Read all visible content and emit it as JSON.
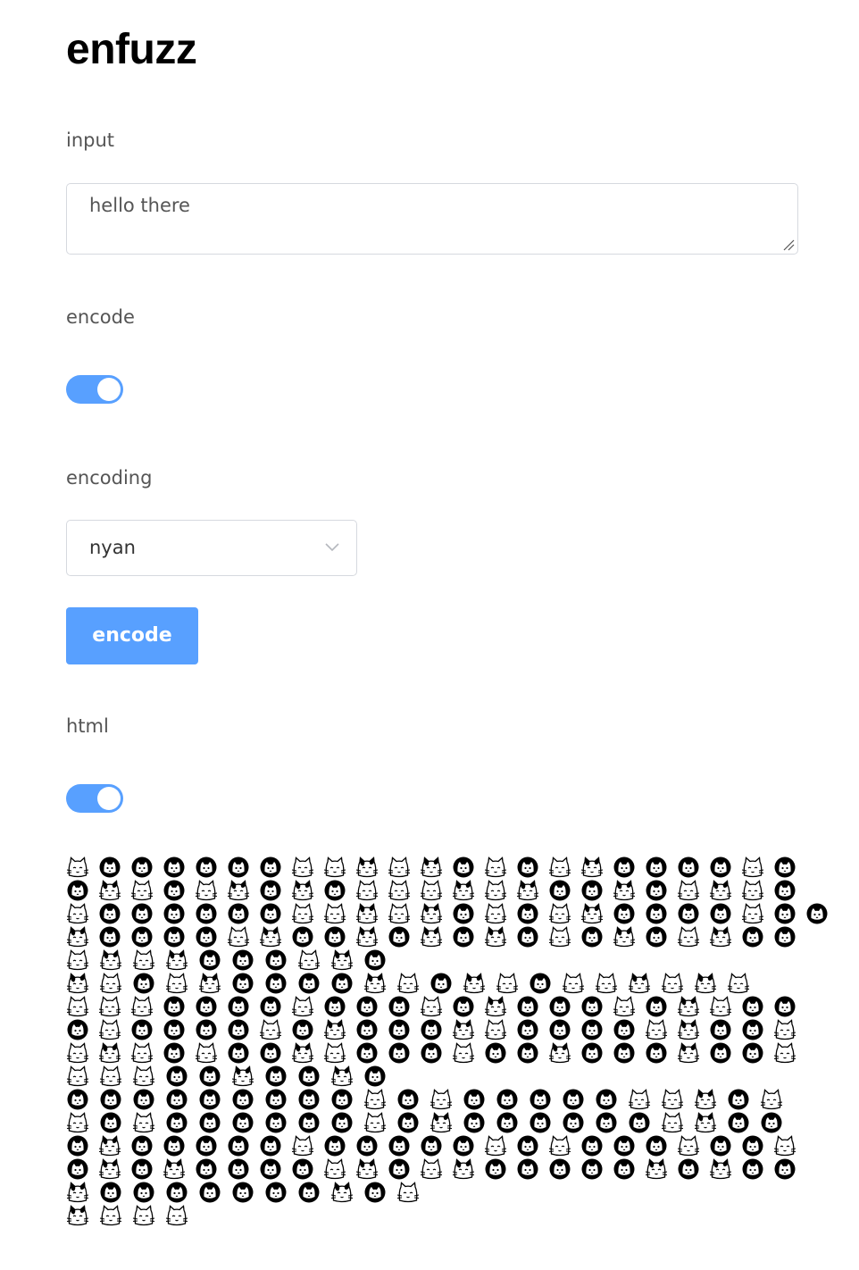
{
  "app": {
    "title": "enfuzz"
  },
  "input": {
    "label": "input",
    "value": "hello there"
  },
  "encode_toggle": {
    "label": "encode",
    "on": true
  },
  "encoding": {
    "label": "encoding",
    "selected": "nyan"
  },
  "encode_button": {
    "label": "encode"
  },
  "html_toggle": {
    "label": "html",
    "on": true
  },
  "colors": {
    "accent": "#58a0ff",
    "text": "#555555",
    "border": "#d6d9df"
  },
  "output": {
    "glyph_type": "cat-face-icon",
    "lines": [
      "wbbbbbbwwcwcbwbwcbbbbwb",
      "bcwbwcbcbwwwcwcbbcbwcwb",
      "wbbbbbbwwcwcbwbwcbbbbwbb",
      "cbbbbwcbbcbcbcbwbcbwcbb",
      "wcwcbbbwcb",
      "cwbwcbbbbcwbcwbwwcwcw",
      "wwwbbbbwbbbwbcbbbwbcwbb",
      "bwbbbbwbcbbbcwbbbbwcbbw",
      "wcwbwbbcwbbbwbbcbbbcbbw",
      "wwwbbcbbcb",
      "bbbbbbbbbwbwbbbbbwwcbw",
      "wbwbbbbbbwbcbbbbbbwcbb",
      "bcbbbbbwbbbbbwbwbbbwbbw",
      "bcbcbbbbwcbwcbbbbbcbcbb",
      "cbbbbbbbcbw",
      "cwww"
    ]
  }
}
